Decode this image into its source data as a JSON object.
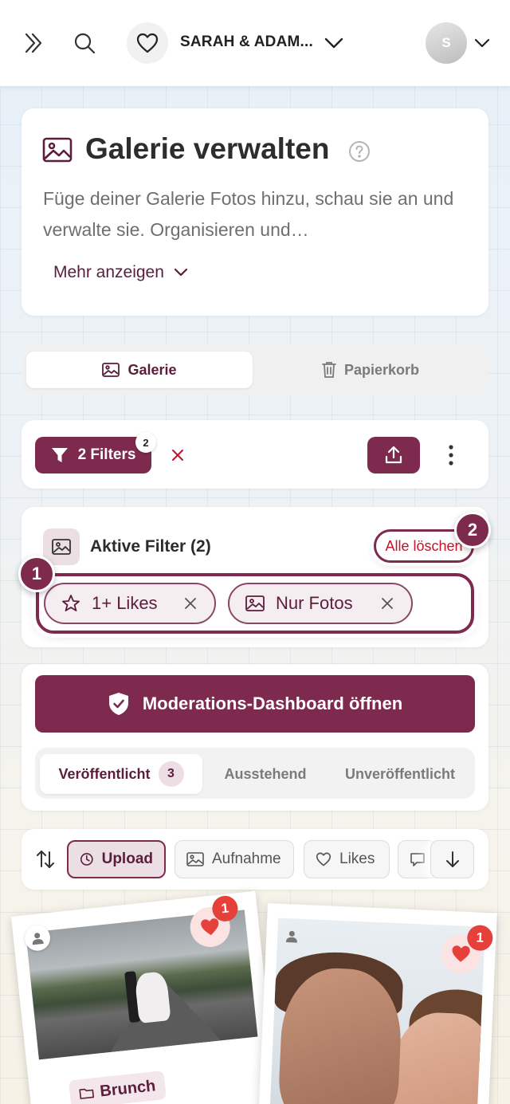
{
  "topbar": {
    "couple_name": "SARAH & ADAM...",
    "avatar_initial": "S"
  },
  "header": {
    "title": "Galerie verwalten",
    "description": "Füge deiner Galerie Fotos hinzu, schau sie an und verwalte sie. Organisieren und…",
    "more_label": "Mehr anzeigen"
  },
  "view_tabs": {
    "gallery": "Galerie",
    "trash": "Papierkorb"
  },
  "filter_bar": {
    "filter_label": "2 Filters",
    "filter_count": "2"
  },
  "active_filters": {
    "title": "Aktive Filter (2)",
    "clear_all": "Alle löschen",
    "chips": [
      "1+ Likes",
      "Nur Fotos"
    ]
  },
  "steps": {
    "step1": "1",
    "step2": "2"
  },
  "moderation": {
    "button_label": "Moderations-Dashboard öffnen",
    "tabs": {
      "published": "Veröffentlicht",
      "published_count": "3",
      "pending": "Ausstehend",
      "unpublished": "Unveröffentlicht"
    }
  },
  "sort": {
    "options": [
      "Upload",
      "Aufnahme",
      "Likes"
    ]
  },
  "photos": [
    {
      "likes": "1",
      "tag": "Brunch"
    },
    {
      "likes": "1"
    }
  ],
  "colors": {
    "accent": "#7d2a4e",
    "danger": "#c0162d",
    "like": "#e5413a"
  }
}
